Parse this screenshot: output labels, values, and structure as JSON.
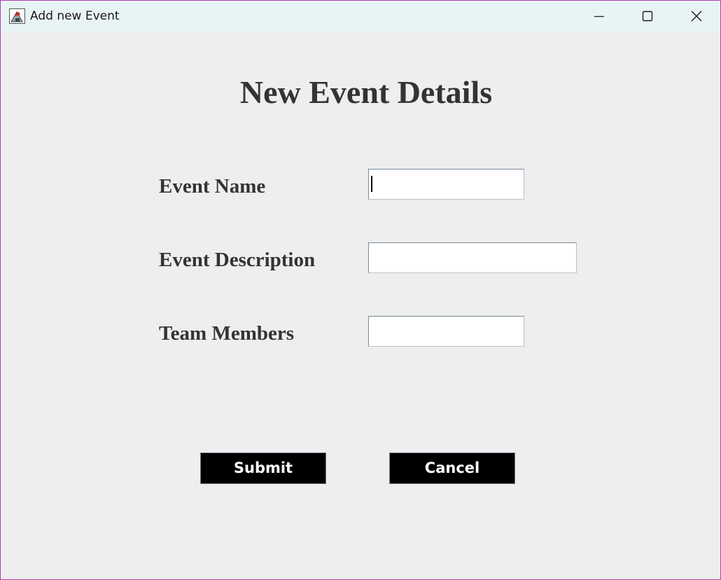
{
  "window": {
    "title": "Add new Event",
    "icon": "java-app-icon",
    "controls": {
      "minimize": "minimize-icon",
      "maximize": "maximize-icon",
      "close": "close-icon"
    }
  },
  "form": {
    "heading": "New Event Details",
    "fields": [
      {
        "label": "Event Name",
        "value": "",
        "focused": true
      },
      {
        "label": "Event Description",
        "value": ""
      },
      {
        "label": "Team Members",
        "value": ""
      }
    ],
    "buttons": {
      "submit": "Submit",
      "cancel": "Cancel"
    }
  },
  "colors": {
    "window_background": "#eeeeee",
    "titlebar_background": "#e8f3f4",
    "text": "#333333",
    "button_background": "#000000",
    "button_text": "#ffffff",
    "window_border": "#b23bb5"
  }
}
